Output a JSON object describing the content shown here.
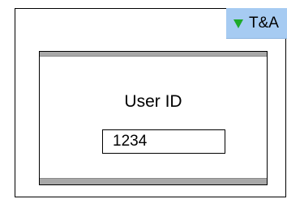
{
  "badge": {
    "label": "T&A",
    "icon": "triangle-down-icon",
    "color": "#a6cbf2",
    "icon_color": "#1faa2a"
  },
  "login": {
    "userid_label": "User ID",
    "userid_value": "1234"
  }
}
